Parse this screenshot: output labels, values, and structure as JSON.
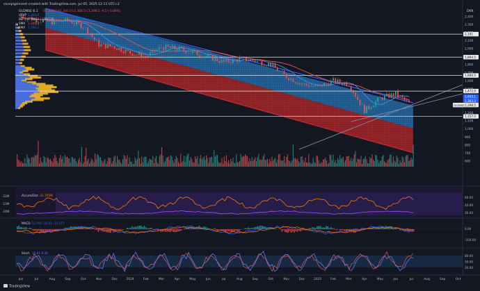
{
  "header": {
    "author_line": "savepigsinvest created with TradingView.com, Jul 05, 2025 12:11 UTC+2",
    "symbol_label": "GLDNSE 6.1",
    "ohlc_text": "O1,338.0 H1,341.0 L1,308.5 C1,298.5 -9.5 (-0.66%)",
    "legend": [
      {
        "name": "VRVP",
        "value": "1,364.0",
        "color": "#2962ff"
      },
      {
        "name": "BB",
        "value": "1,194.2 | 156.238",
        "color": "#b2b5be"
      },
      {
        "name": "SMA",
        "value": "1,388.1",
        "color": "#ef5350"
      },
      {
        "name": "SMA",
        "value": "1,393.3",
        "color": "#2962ff"
      }
    ],
    "currency": "DKK",
    "footer_brand": "TradingView"
  },
  "price_axis": {
    "ticks": [
      "2,400",
      "2,300",
      "2,200",
      "2,100",
      "2,000",
      "1,900",
      "1,800",
      "1,700",
      "1,600",
      "1,500",
      "1,400",
      "1,300",
      "1,200",
      "1,100",
      "1,000",
      "900",
      "800",
      "700",
      "600"
    ],
    "badges": [
      {
        "text": "2,181",
        "kind": "white"
      },
      {
        "text": "1,894.5",
        "kind": "white"
      },
      {
        "text": "1,666.5",
        "kind": "white"
      },
      {
        "text": "1,472.0",
        "kind": "white"
      },
      {
        "text": "1,403.1",
        "kind": "blue"
      },
      {
        "text": "1,393.3",
        "kind": "blue"
      },
      {
        "text": "1,298.5",
        "kind": "white"
      },
      {
        "text": "1,157.0",
        "kind": "white"
      }
    ],
    "badge_label": "GLDNSE",
    "color_white": "#e8e8e8",
    "color_blue": "#2962ff"
  },
  "time_axis": {
    "labels": [
      "Jun",
      "Jul",
      "Aug",
      "Sep",
      "Oct",
      "Nov",
      "Dec",
      "2024",
      "Feb",
      "Mar",
      "Apr",
      "May",
      "Jun",
      "Jul",
      "Aug",
      "Sep",
      "Oct",
      "Nov",
      "Dec",
      "2025",
      "Feb",
      "Mar",
      "Apr",
      "May",
      "Jun",
      "Jul",
      "Aug",
      "Sep",
      "Oct"
    ]
  },
  "indicators": {
    "accum_dist": {
      "label": "Accum/Dist",
      "value": "-25.765M",
      "scale_left": [
        "-22M",
        "-23M",
        "-24M"
      ],
      "scale_right": [
        "60.00",
        "40.00",
        "20.00"
      ]
    },
    "macd": {
      "label": "MACD",
      "values": "-12.292 -25.41 -13.377",
      "scale_right": [
        "0.00",
        "-100.00"
      ]
    },
    "stoch": {
      "label": "Stoch",
      "values": "10.81 8.30",
      "scale_right": [
        "80.00",
        "50.00",
        "20.00"
      ]
    }
  },
  "chart_data": {
    "type": "line",
    "title": "GLDNSE 6.1",
    "xlabel": "",
    "ylabel": "DKK",
    "ylim": [
      600,
      2450
    ],
    "x_range": [
      "2023-06",
      "2025-10"
    ],
    "price_series": [
      {
        "date": "2023-06",
        "close": 2400
      },
      {
        "date": "2023-07",
        "close": 2360
      },
      {
        "date": "2023-08",
        "close": 2330
      },
      {
        "date": "2023-09",
        "close": 2350
      },
      {
        "date": "2023-10",
        "close": 2280
      },
      {
        "date": "2023-11",
        "close": 2050
      },
      {
        "date": "2023-12",
        "close": 2020
      },
      {
        "date": "2024-01",
        "close": 1950
      },
      {
        "date": "2024-02",
        "close": 1900
      },
      {
        "date": "2024-03",
        "close": 2020
      },
      {
        "date": "2024-04",
        "close": 2000
      },
      {
        "date": "2024-05",
        "close": 1950
      },
      {
        "date": "2024-06",
        "close": 1900
      },
      {
        "date": "2024-07",
        "close": 1830
      },
      {
        "date": "2024-08",
        "close": 1870
      },
      {
        "date": "2024-09",
        "close": 1850
      },
      {
        "date": "2024-10",
        "close": 1800
      },
      {
        "date": "2024-11",
        "close": 1650
      },
      {
        "date": "2024-12",
        "close": 1560
      },
      {
        "date": "2025-01",
        "close": 1520
      },
      {
        "date": "2025-02",
        "close": 1600
      },
      {
        "date": "2025-03",
        "close": 1560
      },
      {
        "date": "2025-04",
        "close": 1230
      },
      {
        "date": "2025-05",
        "close": 1380
      },
      {
        "date": "2025-06",
        "close": 1440
      },
      {
        "date": "2025-07",
        "close": 1298.5
      }
    ],
    "horizontal_levels": [
      2181,
      1894.5,
      1666.5,
      1472.0,
      1157.0
    ],
    "channel": {
      "upper": [
        [
          "2023-08",
          2450
        ],
        [
          "2025-07",
          1560
        ]
      ],
      "middle": [
        [
          "2023-08",
          2260
        ],
        [
          "2025-07",
          1140
        ]
      ],
      "lower": [
        [
          "2023-08",
          2000
        ],
        [
          "2025-07",
          930
        ]
      ]
    },
    "colors": {
      "upper_band": "#1f6fb2",
      "lower_band": "#b71c1c",
      "candle_up": "#26a69a",
      "candle_down": "#ef5350",
      "volume_profile": "#f0b429",
      "level": "#e8e8e8"
    }
  }
}
